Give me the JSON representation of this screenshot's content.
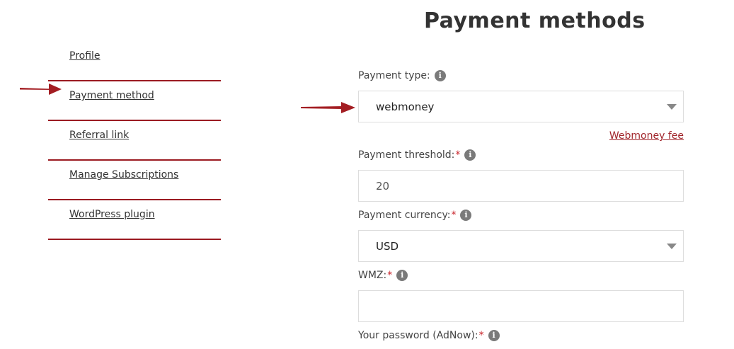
{
  "page_title": "Payment methods",
  "sidebar": {
    "items": [
      {
        "label": "Profile"
      },
      {
        "label": "Payment method"
      },
      {
        "label": "Referral link"
      },
      {
        "label": "Manage Subscriptions"
      },
      {
        "label": "WordPress plugin"
      }
    ]
  },
  "form": {
    "payment_type": {
      "label": "Payment type:",
      "value": "webmoney"
    },
    "fee_link": "Webmoney fee",
    "payment_threshold": {
      "label": "Payment threshold:",
      "required": "*",
      "value": "20"
    },
    "payment_currency": {
      "label": "Payment currency:",
      "required": "*",
      "value": "USD"
    },
    "wmz": {
      "label": "WMZ:",
      "required": "*",
      "value": ""
    },
    "password": {
      "label": "Your password (AdNow):",
      "required": "*"
    }
  },
  "colors": {
    "accent": "#9b1b22",
    "link": "#a1262c",
    "required": "#c9242b"
  }
}
